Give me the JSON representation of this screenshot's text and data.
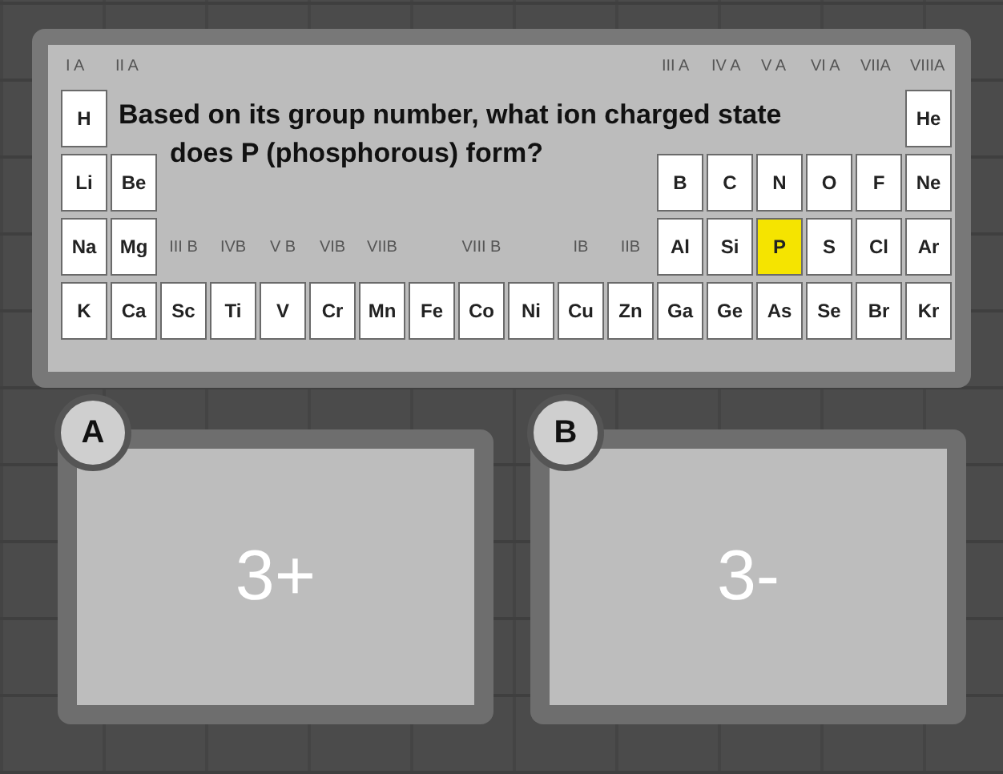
{
  "question": "Based on its group number, what ion charged state does P (phosphorous) form?",
  "a_group_labels": [
    "I A",
    "II A",
    "III A",
    "IV A",
    "V A",
    "VI A",
    "VIIA",
    "VIIIA"
  ],
  "b_group_labels": [
    "III B",
    "IVB",
    "V B",
    "VIB",
    "VIIB",
    "VIII B",
    "IB",
    "IIB"
  ],
  "periods": [
    [
      {
        "symbol": "H",
        "highlighted": false
      },
      {
        "symbol": "He",
        "highlighted": false
      }
    ],
    [
      {
        "symbol": "Li",
        "highlighted": false
      },
      {
        "symbol": "Be",
        "highlighted": false
      },
      {
        "symbol": "B",
        "highlighted": false
      },
      {
        "symbol": "C",
        "highlighted": false
      },
      {
        "symbol": "N",
        "highlighted": false
      },
      {
        "symbol": "O",
        "highlighted": false
      },
      {
        "symbol": "F",
        "highlighted": false
      },
      {
        "symbol": "Ne",
        "highlighted": false
      }
    ],
    [
      {
        "symbol": "Na",
        "highlighted": false
      },
      {
        "symbol": "Mg",
        "highlighted": false
      },
      {
        "symbol": "Al",
        "highlighted": false
      },
      {
        "symbol": "Si",
        "highlighted": false
      },
      {
        "symbol": "P",
        "highlighted": true
      },
      {
        "symbol": "S",
        "highlighted": false
      },
      {
        "symbol": "Cl",
        "highlighted": false
      },
      {
        "symbol": "Ar",
        "highlighted": false
      }
    ],
    [
      {
        "symbol": "K",
        "highlighted": false
      },
      {
        "symbol": "Ca",
        "highlighted": false
      },
      {
        "symbol": "Sc",
        "highlighted": false
      },
      {
        "symbol": "Ti",
        "highlighted": false
      },
      {
        "symbol": "V",
        "highlighted": false
      },
      {
        "symbol": "Cr",
        "highlighted": false
      },
      {
        "symbol": "Mn",
        "highlighted": false
      },
      {
        "symbol": "Fe",
        "highlighted": false
      },
      {
        "symbol": "Co",
        "highlighted": false
      },
      {
        "symbol": "Ni",
        "highlighted": false
      },
      {
        "symbol": "Cu",
        "highlighted": false
      },
      {
        "symbol": "Zn",
        "highlighted": false
      },
      {
        "symbol": "Ga",
        "highlighted": false
      },
      {
        "symbol": "Ge",
        "highlighted": false
      },
      {
        "symbol": "As",
        "highlighted": false
      },
      {
        "symbol": "Se",
        "highlighted": false
      },
      {
        "symbol": "Br",
        "highlighted": false
      },
      {
        "symbol": "Kr",
        "highlighted": false
      }
    ]
  ],
  "answers": [
    {
      "letter": "A",
      "text": "3+"
    },
    {
      "letter": "B",
      "text": "3-"
    }
  ]
}
